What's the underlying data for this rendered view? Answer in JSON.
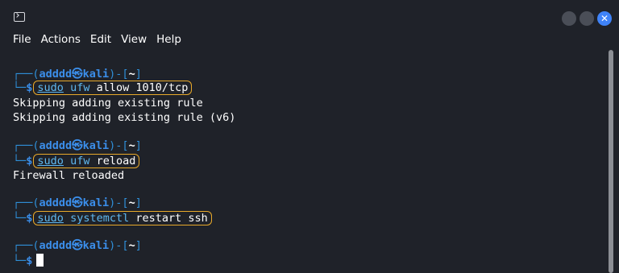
{
  "titlebar": {
    "icon": "terminal-icon",
    "close_symbol": "✕"
  },
  "menu": {
    "items": [
      "File",
      "Actions",
      "Edit",
      "View",
      "Help"
    ]
  },
  "prompt": {
    "open": "┌──(",
    "user": "adddd㉿kali",
    "mid": ")-[",
    "dir": "~",
    "close": "]",
    "lead": "└─",
    "dollar": "$"
  },
  "session": [
    {
      "sudo": "sudo",
      "bin": "ufw",
      "args": "allow 1010/tcp",
      "output": [
        "Skipping adding existing rule",
        "Skipping adding existing rule (v6)"
      ]
    },
    {
      "sudo": "sudo",
      "bin": "ufw",
      "args": "reload",
      "output": [
        "Firewall reloaded"
      ]
    },
    {
      "sudo": "sudo",
      "bin": "systemctl",
      "args": "restart ssh",
      "output": []
    }
  ],
  "colors": {
    "background": "#1f2229",
    "prompt_blue": "#3b8eea",
    "command_cyan": "#5fb8f0",
    "highlight_box": "#e8a92a",
    "close_button": "#3f83f8"
  }
}
